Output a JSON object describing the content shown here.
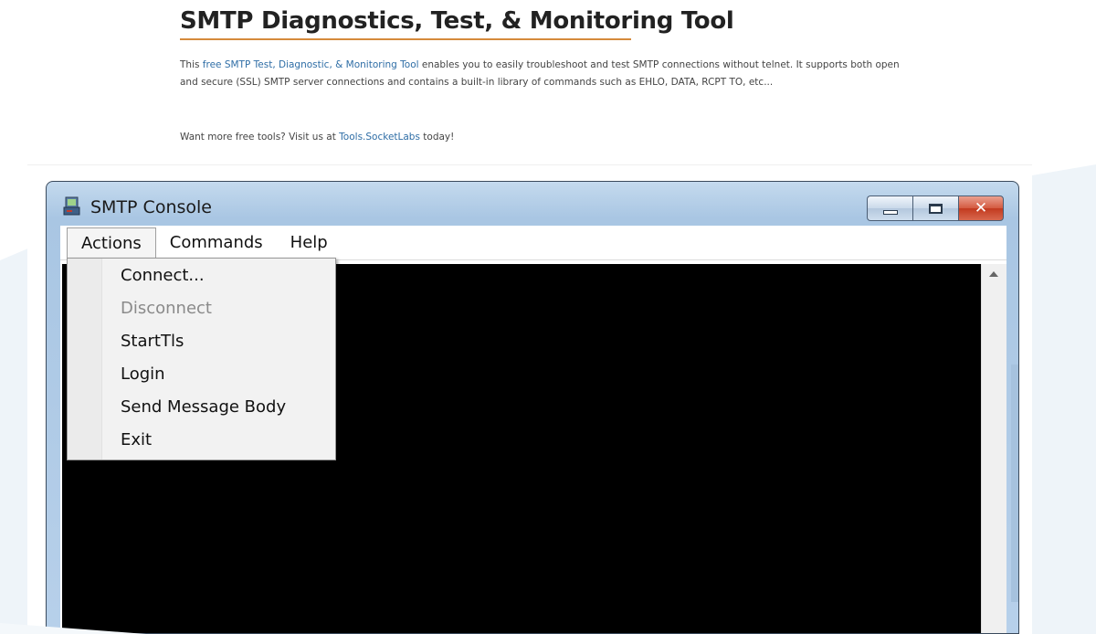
{
  "article": {
    "title": "SMTP Diagnostics, Test, & Monitoring Tool",
    "intro_before_link": "This ",
    "intro_link": "free SMTP Test, Diagnostic, & Monitoring Tool",
    "intro_after_link": " enables you to easily troubleshoot and test SMTP connections without telnet. It supports both open and secure (SSL) SMTP server connections and contains a built-in library of commands such as EHLO, DATA, RCPT TO, etc...",
    "more_before_link": "Want more free tools? Visit us at ",
    "more_link": "Tools.SocketLabs",
    "more_after_link": " today!",
    "accent_color": "#d58a3c",
    "link_color": "#2f6ea6"
  },
  "window": {
    "title": "SMTP Console",
    "icon": "app-icon",
    "buttons": {
      "minimize": "minimize-icon",
      "maximize": "maximize-icon",
      "close": "✕"
    },
    "menu": [
      "Actions",
      "Commands",
      "Help"
    ],
    "active_menu": "Actions",
    "actions_menu": [
      {
        "label": "Connect...",
        "enabled": true
      },
      {
        "label": "Disconnect",
        "enabled": false
      },
      {
        "label": "StartTls",
        "enabled": true
      },
      {
        "label": "Login",
        "enabled": true
      },
      {
        "label": "Send Message Body",
        "enabled": true
      },
      {
        "label": "Exit",
        "enabled": true
      }
    ],
    "console_color": "#000000"
  }
}
